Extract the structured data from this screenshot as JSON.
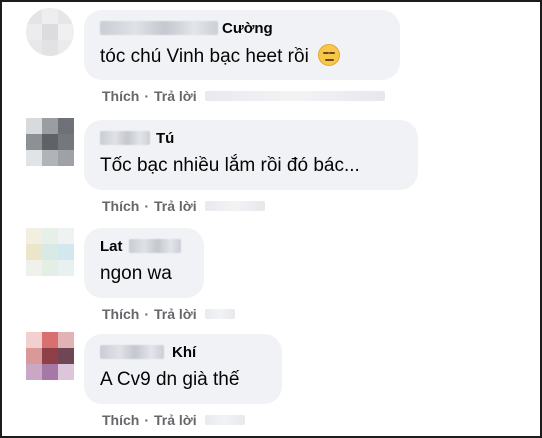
{
  "comments": [
    {
      "author_name": "Cường",
      "text": "tóc chú Vinh bạc heet rồi",
      "emoji": "expressionless-face-icon",
      "actions": {
        "like": "Thích",
        "separator": "·",
        "reply": "Trả lời"
      }
    },
    {
      "author_name": "Tú",
      "text": "Tốc bạc nhiều lắm rồi đó bác...",
      "actions": {
        "like": "Thích",
        "separator": "·",
        "reply": "Trả lời"
      }
    },
    {
      "author_name": "Lat",
      "text": "ngon wa",
      "actions": {
        "like": "Thích",
        "separator": "·",
        "reply": "Trả lời"
      }
    },
    {
      "author_name": "Khí",
      "text": "A Cv9 dn già thế",
      "actions": {
        "like": "Thích",
        "separator": "·",
        "reply": "Trả lời"
      }
    }
  ],
  "colors": {
    "bubble": "#f0f2f5",
    "name": "#050505",
    "action": "#65676b"
  }
}
